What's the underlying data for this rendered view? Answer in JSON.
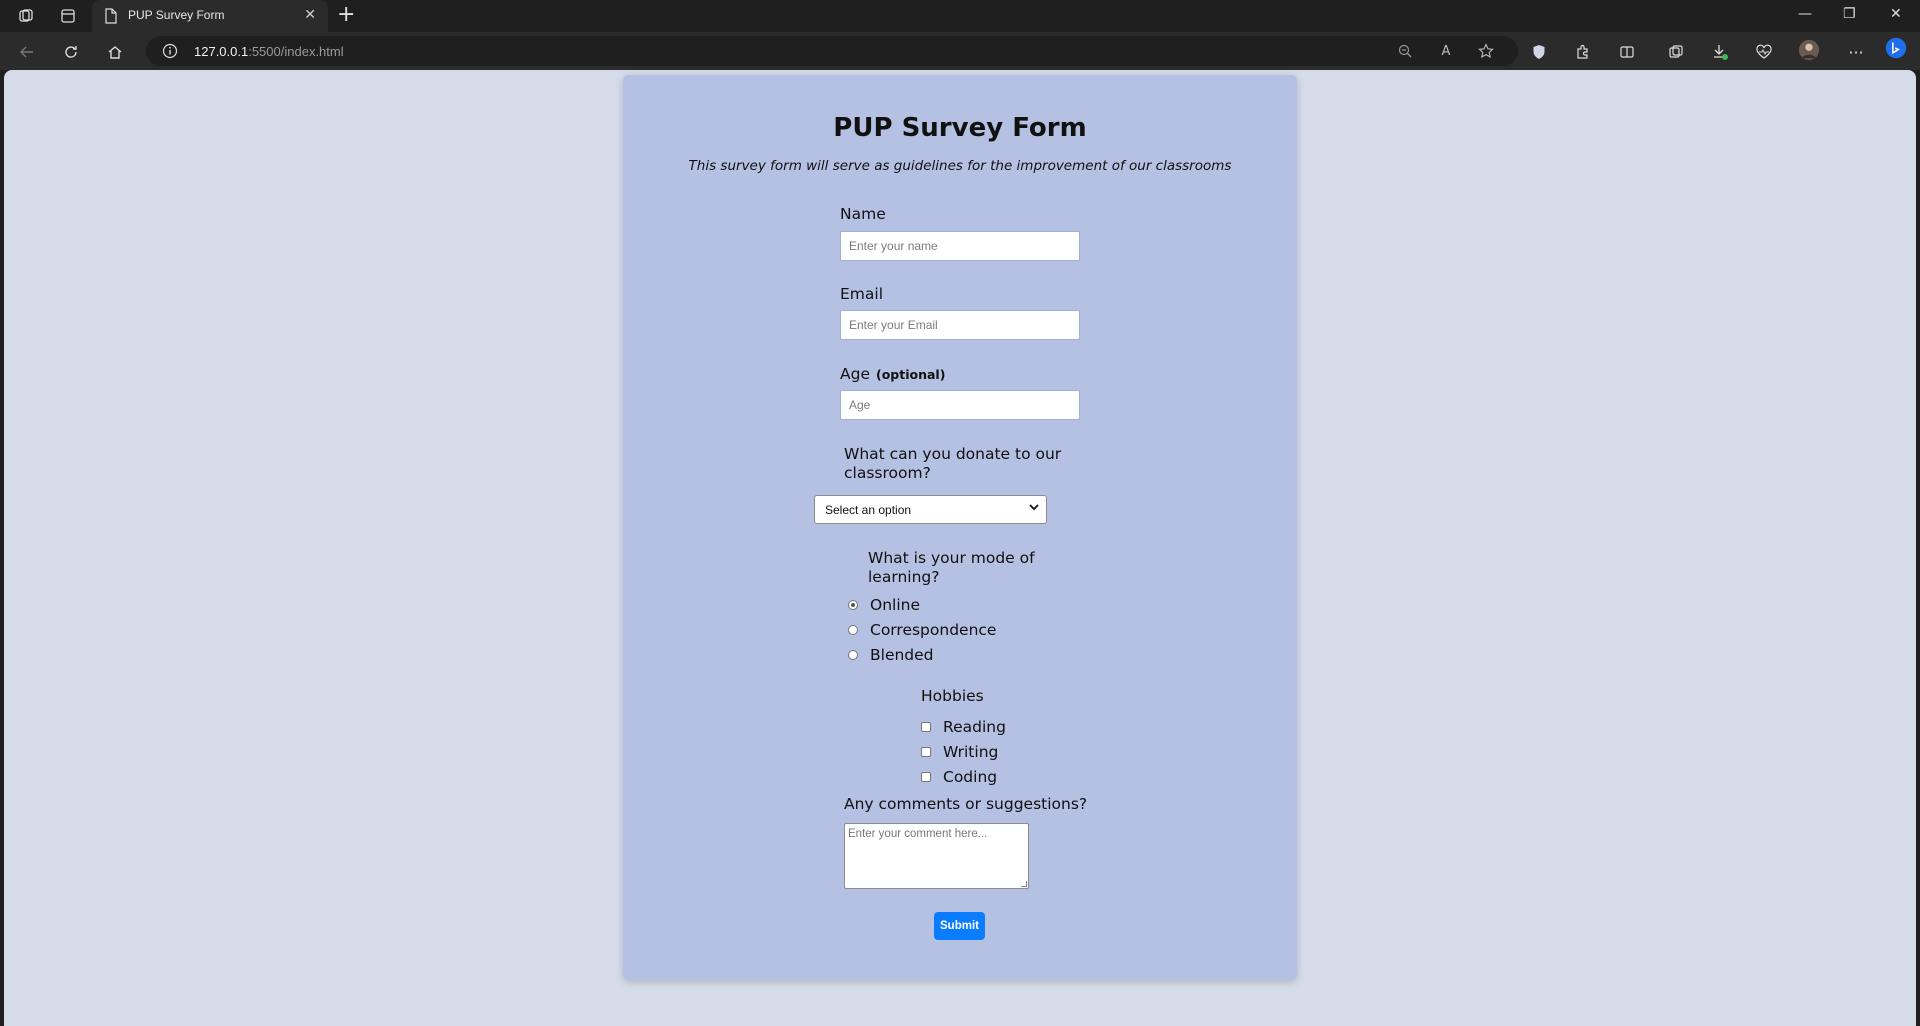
{
  "browser": {
    "tab_title": "PUP Survey Form",
    "url_host": "127.0.0.1",
    "url_rest": ":5500/index.html"
  },
  "form": {
    "title": "PUP Survey Form",
    "subtitle": "This survey form will serve as guidelines for the improvement of our classrooms",
    "name_label": "Name",
    "name_placeholder": "Enter your name",
    "email_label": "Email",
    "email_placeholder": "Enter your Email",
    "age_label": "Age",
    "age_optional": "(optional)",
    "age_placeholder": "Age",
    "donate_label_line1": "What can you donate to our",
    "donate_label_line2": "classroom?",
    "donate_selected": "Select an option",
    "mode_label_line1": "What is your mode of",
    "mode_label_line2": "learning?",
    "mode_options": [
      "Online",
      "Correspondence",
      "Blended"
    ],
    "mode_selected": "Online",
    "hobbies_label": "Hobbies",
    "hobbies": [
      "Reading",
      "Writing",
      "Coding"
    ],
    "comments_label": "Any comments or suggestions?",
    "comments_placeholder": "Enter your comment here...",
    "submit_label": "Submit"
  }
}
